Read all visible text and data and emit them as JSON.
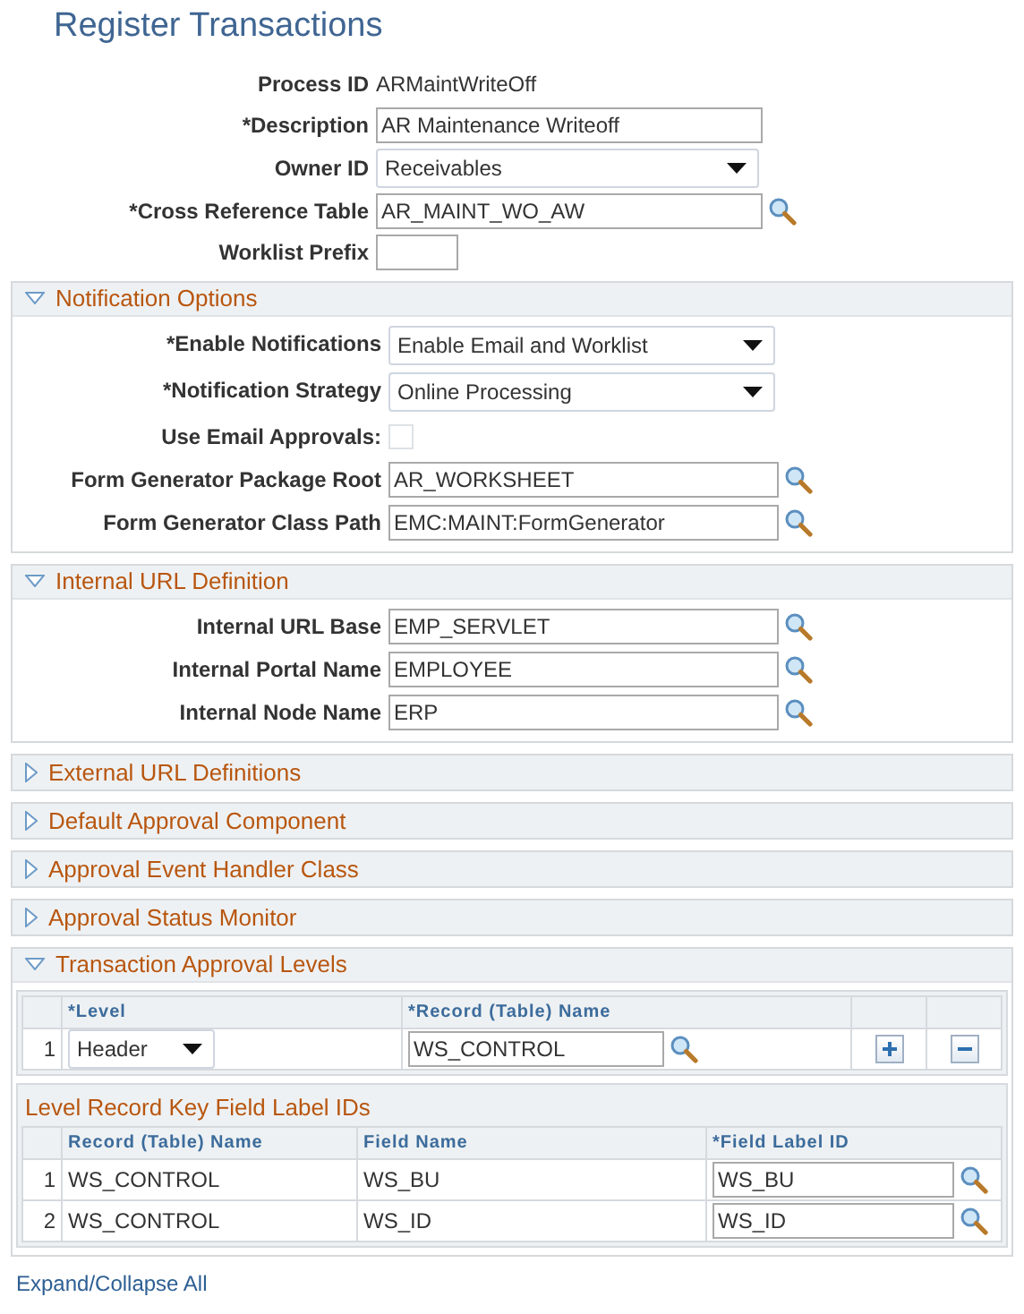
{
  "page_title": "Register Transactions",
  "fields": [
    {
      "kind": "display",
      "label": "Process ID",
      "value": "ARMaintWriteOff"
    },
    {
      "kind": "text",
      "label": "*Description",
      "value": "AR Maintenance Writeoff"
    },
    {
      "kind": "select",
      "label": "Owner ID",
      "value": "Receivables"
    },
    {
      "kind": "lookup",
      "label": "*Cross Reference Table",
      "value": "AR_MAINT_WO_AW"
    },
    {
      "kind": "short",
      "label": "Worklist Prefix"
    }
  ],
  "sections": [
    {
      "title": "Notification Options",
      "expanded": true,
      "fields": [
        {
          "kind": "select",
          "label": "*Enable Notifications",
          "value": "Enable Email and Worklist"
        },
        {
          "kind": "select",
          "label": "*Notification Strategy",
          "value": "Online Processing"
        },
        {
          "kind": "checkbox",
          "label": "Use Email Approvals:",
          "checked": false
        },
        {
          "kind": "lookup",
          "label": "Form Generator Package Root",
          "value": "AR_WORKSHEET"
        },
        {
          "kind": "lookup",
          "label": "Form Generator Class Path",
          "value": "EMC:MAINT:FormGenerator"
        }
      ]
    },
    {
      "title": "Internal URL Definition",
      "expanded": true,
      "fields": [
        {
          "kind": "lookup",
          "label": "Internal URL Base",
          "value": "EMP_SERVLET"
        },
        {
          "kind": "lookup",
          "label": "Internal Portal Name",
          "value": "EMPLOYEE"
        },
        {
          "kind": "lookup",
          "label": "Internal Node Name",
          "value": "ERP"
        }
      ]
    },
    {
      "title": "External URL Definitions",
      "expanded": false
    },
    {
      "title": "Default Approval Component",
      "expanded": false
    },
    {
      "title": "Approval Event Handler Class",
      "expanded": false
    },
    {
      "title": "Approval Status Monitor",
      "expanded": false
    },
    {
      "title": "Transaction Approval Levels",
      "expanded": true,
      "grid": {
        "columns": [
          "*Level",
          "*Record (Table) Name"
        ],
        "rows": [
          {
            "number": "1",
            "level": "Header",
            "record": "WS_CONTROL"
          }
        ],
        "subgrid": {
          "title": "Level Record Key Field Label IDs",
          "columns": [
            "Record (Table) Name",
            "Field Name",
            "*Field Label ID"
          ],
          "rows": [
            {
              "number": "1",
              "record": "WS_CONTROL",
              "field": "WS_BU",
              "label_id": "WS_BU"
            },
            {
              "number": "2",
              "record": "WS_CONTROL",
              "field": "WS_ID",
              "label_id": "WS_ID"
            }
          ]
        }
      }
    }
  ],
  "footer_link": "Expand/Collapse All"
}
